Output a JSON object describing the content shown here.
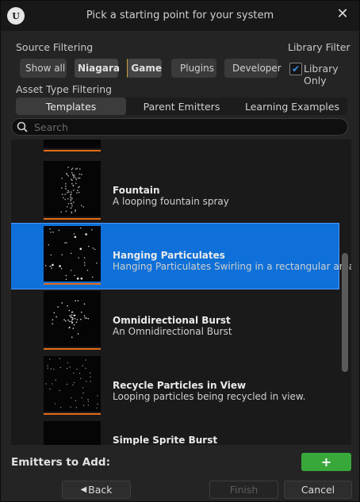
{
  "window": {
    "title": "Pick a starting point for your system"
  },
  "source_filtering": {
    "label": "Source Filtering",
    "chips": [
      {
        "label": "Show all",
        "color": ""
      },
      {
        "label": "Niagara",
        "color": "#d9c7c7"
      },
      {
        "label": "Game",
        "color": "#c8a046"
      },
      {
        "label": "Plugins",
        "color": ""
      },
      {
        "label": "Developer",
        "color": ""
      }
    ]
  },
  "library_filter": {
    "label": "Library Filter",
    "checkbox_label": "Library Only",
    "checked": true
  },
  "asset_type": {
    "label": "Asset Type Filtering",
    "tabs": [
      {
        "label": "Templates",
        "selected": true
      },
      {
        "label": "Parent Emitters",
        "selected": false
      },
      {
        "label": "Learning Examples",
        "selected": false
      }
    ]
  },
  "search": {
    "placeholder": "Search"
  },
  "templates": [
    {
      "name": "Fountain",
      "description": "A looping fountain spray",
      "selected": false
    },
    {
      "name": "Hanging Particulates",
      "description": "Hanging Particulates Swirling in a rectangular area",
      "selected": true
    },
    {
      "name": "Omnidirectional Burst",
      "description": "An Omnidirectional Burst",
      "selected": false
    },
    {
      "name": "Recycle Particles in View",
      "description": "Looping particles being recycled in view.",
      "selected": false
    },
    {
      "name": "Simple Sprite Burst",
      "description": "",
      "selected": false
    }
  ],
  "footer": {
    "emitters_label": "Emitters to Add:",
    "add_symbol": "+",
    "back_label": "Back",
    "finish_label": "Finish",
    "cancel_label": "Cancel"
  },
  "colors": {
    "accent": "#0e70d8",
    "thumb_bar": "#e66a14",
    "add_button": "#38a83b",
    "checkbox": "#3d8ee6"
  }
}
